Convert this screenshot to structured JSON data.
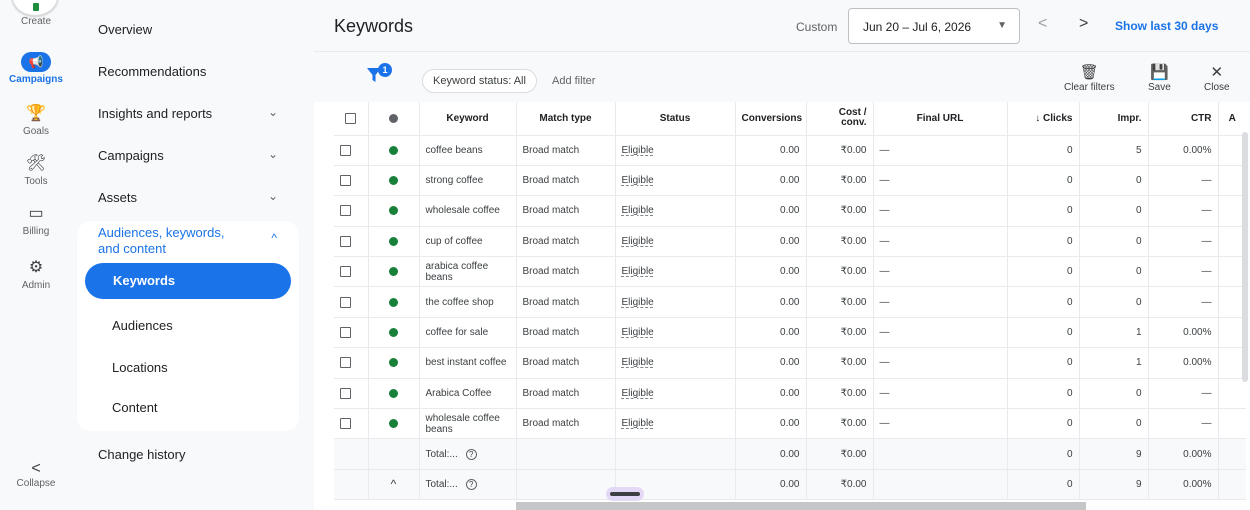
{
  "rail": {
    "create_label": "Create",
    "items": [
      {
        "label": "Campaigns",
        "icon": "megaphone-icon",
        "glyph": "📢",
        "active": true
      },
      {
        "label": "Goals",
        "icon": "trophy-icon",
        "glyph": "🏆"
      },
      {
        "label": "Tools",
        "icon": "tools-icon",
        "glyph": "🛠"
      },
      {
        "label": "Billing",
        "icon": "credit-card-icon",
        "glyph": "▭"
      },
      {
        "label": "Admin",
        "icon": "gear-icon",
        "glyph": "⚙"
      }
    ],
    "collapse_label": "Collapse",
    "collapse_glyph": "<"
  },
  "nav": {
    "overview": "Overview",
    "recommendations": "Recommendations",
    "insights": "Insights and reports",
    "campaigns": "Campaigns",
    "assets": "Assets",
    "audiences_group": "Audiences, keywords, and content",
    "keywords": "Keywords",
    "audiences": "Audiences",
    "locations": "Locations",
    "content": "Content",
    "change_history": "Change history",
    "chevron_down": "⌄",
    "chevron_up": "^"
  },
  "header": {
    "title": "Keywords",
    "custom_label": "Custom",
    "date_range": "Jun 20 – Jul 6, 2026",
    "dropdown_glyph": "▼",
    "prev_glyph": "<",
    "next_glyph": ">",
    "show_last": "Show last 30 days"
  },
  "toolbar": {
    "filter_count": "1",
    "chip": "Keyword status: All",
    "add_filter": "Add filter",
    "clear_filters": "Clear filters",
    "save": "Save",
    "close": "Close",
    "clear_glyph": "🗑",
    "save_glyph": "💾",
    "close_glyph": "✕"
  },
  "table": {
    "headers": {
      "keyword": "Keyword",
      "match_type": "Match type",
      "status": "Status",
      "conversions": "Conversions",
      "cost_conv": "Cost / conv.",
      "final_url": "Final URL",
      "clicks": "↓ Clicks",
      "impr": "Impr.",
      "ctr": "CTR",
      "next": "A"
    },
    "rows": [
      {
        "keyword": "coffee beans",
        "match": "Broad match",
        "status": "Eligible",
        "conversions": "0.00",
        "cost": "₹0.00",
        "url": "—",
        "clicks": "0",
        "impr": "5",
        "ctr": "0.00%"
      },
      {
        "keyword": "strong coffee",
        "match": "Broad match",
        "status": "Eligible",
        "conversions": "0.00",
        "cost": "₹0.00",
        "url": "—",
        "clicks": "0",
        "impr": "0",
        "ctr": "—"
      },
      {
        "keyword": "wholesale coffee",
        "match": "Broad match",
        "status": "Eligible",
        "conversions": "0.00",
        "cost": "₹0.00",
        "url": "—",
        "clicks": "0",
        "impr": "0",
        "ctr": "—"
      },
      {
        "keyword": "cup of coffee",
        "match": "Broad match",
        "status": "Eligible",
        "conversions": "0.00",
        "cost": "₹0.00",
        "url": "—",
        "clicks": "0",
        "impr": "0",
        "ctr": "—"
      },
      {
        "keyword": "arabica coffee beans",
        "match": "Broad match",
        "status": "Eligible",
        "conversions": "0.00",
        "cost": "₹0.00",
        "url": "—",
        "clicks": "0",
        "impr": "0",
        "ctr": "—"
      },
      {
        "keyword": "the coffee shop",
        "match": "Broad match",
        "status": "Eligible",
        "conversions": "0.00",
        "cost": "₹0.00",
        "url": "—",
        "clicks": "0",
        "impr": "0",
        "ctr": "—"
      },
      {
        "keyword": "coffee for sale",
        "match": "Broad match",
        "status": "Eligible",
        "conversions": "0.00",
        "cost": "₹0.00",
        "url": "—",
        "clicks": "0",
        "impr": "1",
        "ctr": "0.00%"
      },
      {
        "keyword": "best instant coffee",
        "match": "Broad match",
        "status": "Eligible",
        "conversions": "0.00",
        "cost": "₹0.00",
        "url": "—",
        "clicks": "0",
        "impr": "1",
        "ctr": "0.00%"
      },
      {
        "keyword": "Arabica Coffee",
        "match": "Broad match",
        "status": "Eligible",
        "conversions": "0.00",
        "cost": "₹0.00",
        "url": "—",
        "clicks": "0",
        "impr": "0",
        "ctr": "—"
      },
      {
        "keyword": "wholesale coffee beans",
        "match": "Broad match",
        "status": "Eligible",
        "conversions": "0.00",
        "cost": "₹0.00",
        "url": "—",
        "clicks": "0",
        "impr": "0",
        "ctr": "—"
      }
    ],
    "totals": [
      {
        "label": "Total:...",
        "expand": "",
        "conversions": "0.00",
        "cost": "₹0.00",
        "clicks": "0",
        "impr": "9",
        "ctr": "0.00%"
      },
      {
        "label": "Total:...",
        "expand": "^",
        "conversions": "0.00",
        "cost": "₹0.00",
        "clicks": "0",
        "impr": "9",
        "ctr": "0.00%"
      }
    ],
    "help_glyph": "?"
  }
}
